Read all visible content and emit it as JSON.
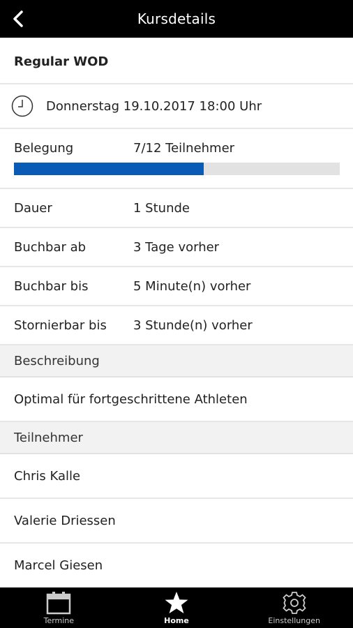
{
  "header": {
    "title": "Kursdetails"
  },
  "course": {
    "name": "Regular WOD",
    "datetime": "Donnerstag 19.10.2017 18:00 Uhr",
    "occupancy_label": "Belegung",
    "occupancy_value": "7/12 Teilnehmer",
    "occupancy_fraction": 0.5833,
    "details": [
      {
        "label": "Dauer",
        "value": "1 Stunde"
      },
      {
        "label": "Buchbar ab",
        "value": "3 Tage vorher"
      },
      {
        "label": "Buchbar bis",
        "value": "5 Minute(n) vorher"
      },
      {
        "label": "Stornierbar bis",
        "value": "3 Stunde(n) vorher"
      }
    ]
  },
  "description": {
    "header": "Beschreibung",
    "text": "Optimal für fortgeschrittene Athleten"
  },
  "participants": {
    "header": "Teilnehmer",
    "names": [
      "Chris Kalle",
      "Valerie Driessen",
      "Marcel Giesen"
    ]
  },
  "tabbar": {
    "items": [
      {
        "label": "Termine",
        "icon": "calendar-icon"
      },
      {
        "label": "Home",
        "icon": "star-icon",
        "active": true
      },
      {
        "label": "Einstellungen",
        "icon": "gear-icon"
      }
    ]
  },
  "colors": {
    "progress_fill": "#0a5bb5",
    "progress_track": "#e2e2e2",
    "bars": "#000000"
  }
}
